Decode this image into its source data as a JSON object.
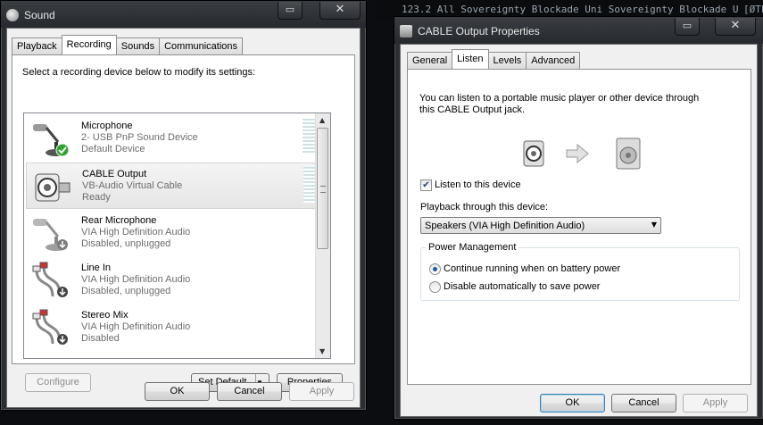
{
  "background": {
    "strip_text": "123.2 All Sovereignty Blockade Uni Sovereignty Blockade U",
    "strip_tag": "[ØTL]"
  },
  "sound": {
    "title": "Sound",
    "tabs": [
      "Playback",
      "Recording",
      "Sounds",
      "Communications"
    ],
    "active_tab": "Recording",
    "instruction": "Select a recording device below to modify its settings:",
    "devices": [
      {
        "name": "Microphone",
        "line2": "2- USB PnP Sound Device",
        "line3": "Default Device",
        "icon": "microphone-icon",
        "status": "default-check"
      },
      {
        "name": "CABLE Output",
        "line2": "VB-Audio Virtual Cable",
        "line3": "Ready",
        "icon": "virtual-cable-icon",
        "status": "none"
      },
      {
        "name": "Rear Microphone",
        "line2": "VIA High Definition Audio",
        "line3": "Disabled, unplugged",
        "icon": "microphone-icon",
        "status": "disabled-arrow"
      },
      {
        "name": "Line In",
        "line2": "VIA High Definition Audio",
        "line3": "Disabled, unplugged",
        "icon": "rca-cable-icon",
        "status": "disabled-arrow"
      },
      {
        "name": "Stereo Mix",
        "line2": "VIA High Definition Audio",
        "line3": "Disabled",
        "icon": "rca-cable-icon",
        "status": "disabled-arrow"
      }
    ],
    "configure_label": "Configure",
    "set_default_label": "Set Default",
    "properties_label": "Properties",
    "ok_label": "OK",
    "cancel_label": "Cancel",
    "apply_label": "Apply"
  },
  "cable": {
    "title": "CABLE Output Properties",
    "tabs": [
      "General",
      "Listen",
      "Levels",
      "Advanced"
    ],
    "active_tab": "Listen",
    "description_1": "You can listen to a portable music player or other device through",
    "description_2": "this CABLE Output jack.",
    "listen_label": "Listen to this device",
    "listen_checked": true,
    "playback_label": "Playback through this device:",
    "playback_value": "Speakers (VIA High Definition Audio)",
    "power_group_label": "Power Management",
    "power_options": [
      {
        "label": "Continue running when on battery power",
        "selected": true
      },
      {
        "label": "Disable automatically to save power",
        "selected": false
      }
    ],
    "ok_label": "OK",
    "cancel_label": "Cancel",
    "apply_label": "Apply"
  }
}
